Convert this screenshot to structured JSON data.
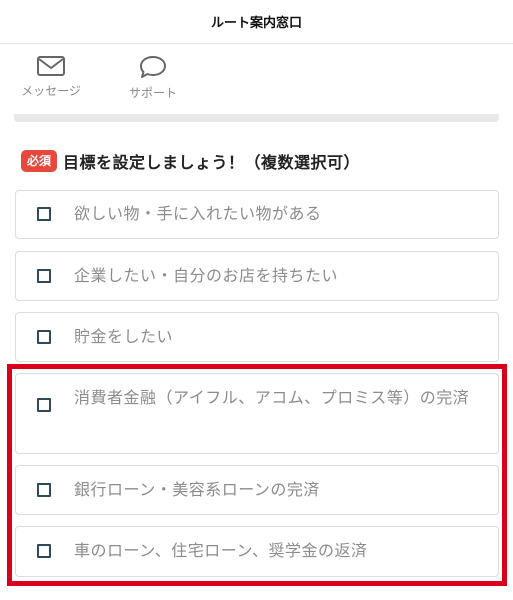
{
  "header": {
    "title": "ルート案内窓口"
  },
  "tabs": [
    {
      "label": "メッセージ",
      "icon": "mail-icon"
    },
    {
      "label": "サポート",
      "icon": "chat-bubble-icon"
    }
  ],
  "question": {
    "badge": "必須",
    "title": "目標を設定しましょう！（複数選択可）"
  },
  "options": [
    {
      "label": "欲しい物・手に入れたい物がある",
      "checked": false
    },
    {
      "label": "企業したい・自分のお店を持ちたい",
      "checked": false
    },
    {
      "label": "貯金をしたい",
      "checked": false
    },
    {
      "label": "消費者金融（アイフル、アコム、プロミス等）の完済",
      "checked": false
    },
    {
      "label": "銀行ローン・美容系ローンの完済",
      "checked": false
    },
    {
      "label": "車のローン、住宅ローン、奨学金の返済",
      "checked": false
    }
  ],
  "colors": {
    "badge": "#e8483c",
    "highlight": "#d9001b",
    "checkbox": "#2f4a5f"
  }
}
